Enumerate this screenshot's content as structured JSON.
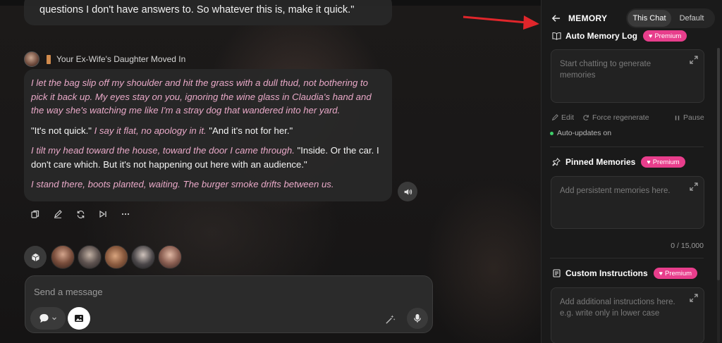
{
  "chat": {
    "previous_message": "questions I don't have answers to. So whatever this is, make it quick.\"",
    "message": {
      "title": "Your Ex-Wife's Daughter Moved In",
      "paragraphs": [
        [
          {
            "t": "I let the bag slip off my shoulder and hit the grass with a dull thud, not bothering to pick it back up. My eyes stay on you, ignoring the wine glass in Claudia's hand and the way she's watching me like I'm a stray dog that wandered into her yard.",
            "style": "italic"
          }
        ],
        [
          {
            "t": "\"It's not quick.\" ",
            "style": "speech"
          },
          {
            "t": "I say it flat, no apology in it.",
            "style": "italic"
          },
          {
            "t": " \"And it's not for her.\"",
            "style": "speech"
          }
        ],
        [
          {
            "t": "I tilt my head toward the house, toward the door I came through.",
            "style": "italic"
          },
          {
            "t": " \"Inside. Or the car. I don't care which. But it's not happening out here with an audience.\"",
            "style": "speech"
          }
        ],
        [
          {
            "t": "I stand there, boots planted, waiting. The burger smoke drifts between us.",
            "style": "italic"
          }
        ]
      ]
    },
    "actions": [
      "copy-icon",
      "edit-icon",
      "regenerate-icon",
      "continue-icon",
      "more-icon"
    ],
    "characters": [
      "character-1",
      "character-2",
      "character-3",
      "character-4",
      "character-5"
    ],
    "composer": {
      "placeholder": "Send a message"
    }
  },
  "panel": {
    "title": "MEMORY",
    "tabs": {
      "active": "This Chat",
      "inactive": "Default"
    },
    "auto_log": {
      "title": "Auto Memory Log",
      "badge": "Premium",
      "placeholder": "Start chatting to generate memories",
      "edit": "Edit",
      "force": "Force regenerate",
      "pause": "Pause",
      "status": "Auto-updates on"
    },
    "pinned": {
      "title": "Pinned Memories",
      "badge": "Premium",
      "placeholder": "Add persistent memories here.",
      "count": "0 / 15,000"
    },
    "custom": {
      "title": "Custom Instructions",
      "badge": "Premium",
      "placeholder": "Add additional instructions here.\ne.g. write only in lower case"
    }
  },
  "colors": {
    "premium": "#e83e8c",
    "italic_text": "#e9a9c8",
    "status_dot": "#3ecf6a",
    "annotation_arrow": "#e0262b"
  }
}
